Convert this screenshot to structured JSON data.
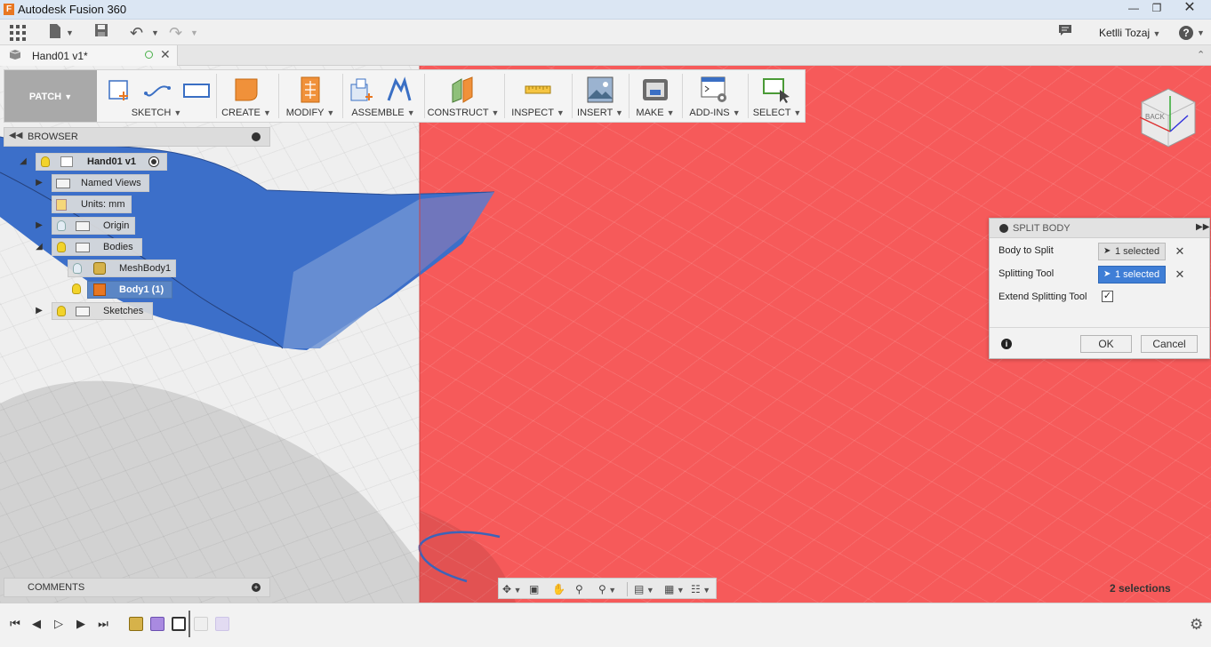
{
  "window": {
    "title": "Autodesk Fusion 360",
    "app_icon": "F"
  },
  "quick_access": {
    "user_name": "Ketlli Tozaj"
  },
  "document_tab": {
    "label": "Hand01 v1*"
  },
  "toolbar": {
    "workspace": "PATCH",
    "groups": [
      {
        "label": "SKETCH"
      },
      {
        "label": "CREATE"
      },
      {
        "label": "MODIFY"
      },
      {
        "label": "ASSEMBLE"
      },
      {
        "label": "CONSTRUCT"
      },
      {
        "label": "INSPECT"
      },
      {
        "label": "INSERT"
      },
      {
        "label": "MAKE"
      },
      {
        "label": "ADD-INS"
      },
      {
        "label": "SELECT"
      }
    ]
  },
  "browser": {
    "title": "BROWSER",
    "root": "Hand01 v1",
    "items": [
      {
        "label": "Named Views"
      },
      {
        "label": "Units: mm"
      },
      {
        "label": "Origin"
      },
      {
        "label": "Bodies"
      },
      {
        "label": "MeshBody1"
      },
      {
        "label": "Body1 (1)"
      },
      {
        "label": "Sketches"
      }
    ]
  },
  "comments": {
    "title": "COMMENTS"
  },
  "split_body": {
    "title": "SPLIT BODY",
    "rows": [
      {
        "label": "Body to Split",
        "value": "1 selected"
      },
      {
        "label": "Splitting Tool",
        "value": "1 selected"
      },
      {
        "label": "Extend Splitting Tool"
      }
    ],
    "extend_checked": true,
    "ok_label": "OK",
    "cancel_label": "Cancel"
  },
  "status": {
    "selection_count": "2 selections"
  },
  "viewcube": {
    "face_label": "BACK"
  },
  "colors": {
    "accent": "#3f7ed6",
    "split_plane": "#f65a5a",
    "body_blue": "#3c6fc9",
    "tool_orange": "#e87722"
  }
}
